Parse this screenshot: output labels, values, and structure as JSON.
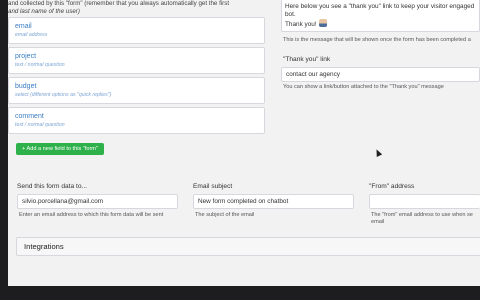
{
  "intro": {
    "line1": "and collected by this \"form\" (remember that you always automatically get the first",
    "line2": "and last name of the user)"
  },
  "fields": [
    {
      "name": "email",
      "type": "email address"
    },
    {
      "name": "project",
      "type": "text / normal question"
    },
    {
      "name": "budget",
      "type": "select (different options as \"quick replies\")"
    },
    {
      "name": "comment",
      "type": "text / normal question"
    }
  ],
  "add_field_label": "+ Add a new field to this \"form\"",
  "thank_you": {
    "message_line1": "Here below you see a \"thank you\" link to keep your visitor engaged",
    "message_line2": "bot.",
    "message_line3": "Thank you!",
    "help": "This is the message that will be shown once the form has been completed a",
    "link_label": "\"Thank you\" link",
    "link_value": "contact our agency",
    "link_help": "You can show a link/button attached to the \"Thank you\" message"
  },
  "send_to": {
    "label": "Send this form data to...",
    "value": "silvio.porcellana@gmail.com",
    "help": "Enter an email address to which this form data will be sent"
  },
  "subject": {
    "label": "Email subject",
    "value": "New form completed on chatbot",
    "help": "The subject of the email"
  },
  "from": {
    "label": "\"From\" address",
    "value": "",
    "help_line1": "The \"from\" email address to use when se",
    "help_line2": "email"
  },
  "integrations_label": "Integrations",
  "colors": {
    "add_button": "#2eb14b",
    "field_name": "#3a7cc2",
    "background": "#f2f2f3",
    "outer": "#1d1d1f"
  }
}
